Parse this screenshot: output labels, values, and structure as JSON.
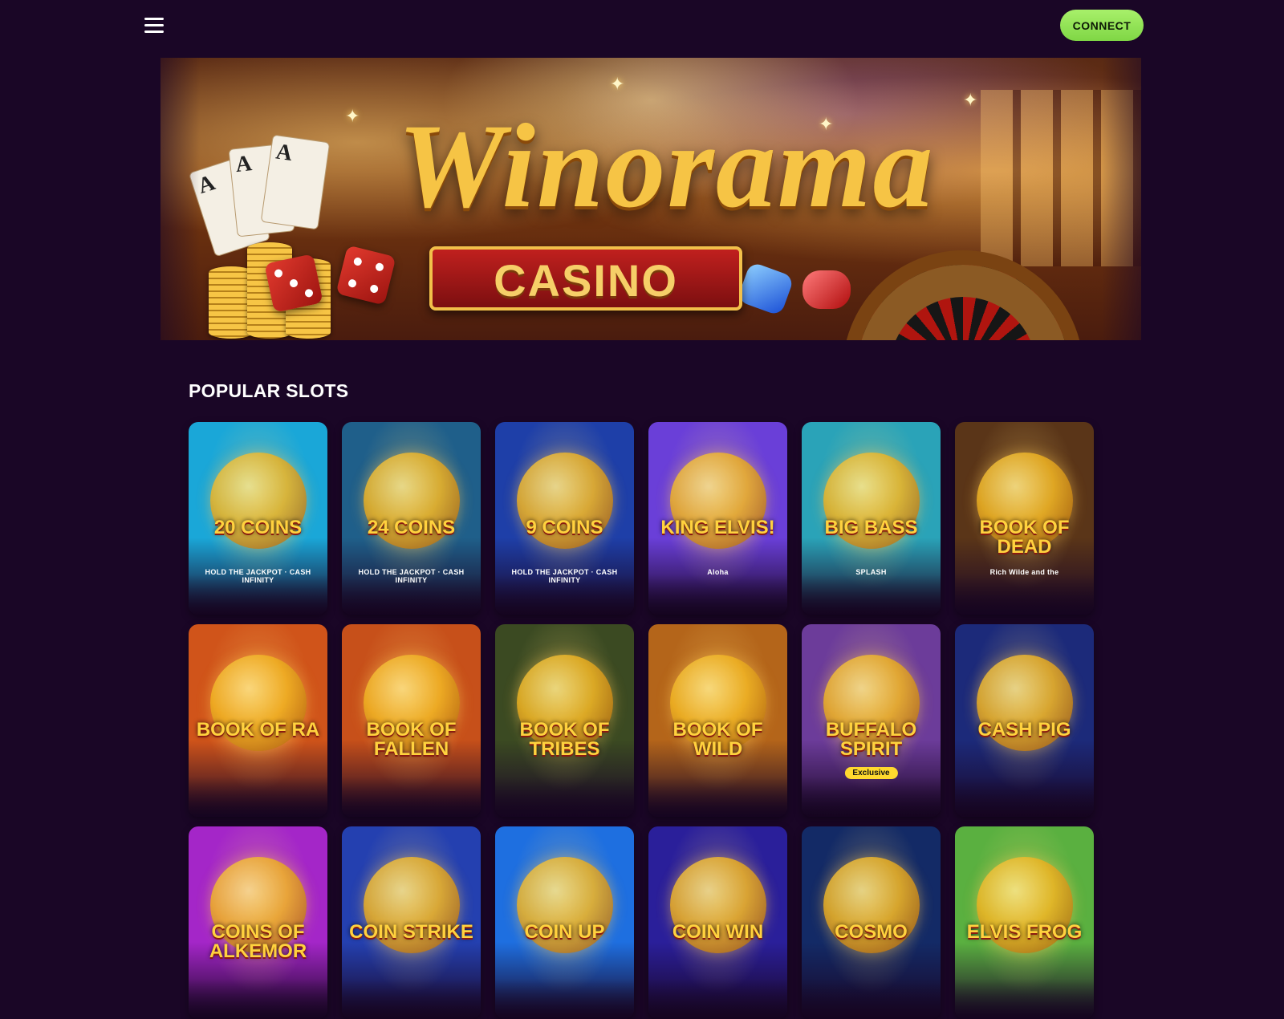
{
  "header": {
    "menu_icon": "hamburger-menu-icon",
    "connect_label": "CONNECT",
    "accent_color": "#8fe356"
  },
  "hero": {
    "brand": "Winorama",
    "brand_sub": "CASINO"
  },
  "section": {
    "title": "POPULAR SLOTS"
  },
  "slots": [
    {
      "title": "20 Coins",
      "sub": "HOLD THE JACKPOT · CASH INFINITY",
      "bg": "#1aa7d8"
    },
    {
      "title": "24 Coins",
      "sub": "HOLD THE JACKPOT · CASH INFINITY",
      "bg": "#1f5f8a"
    },
    {
      "title": "9 Coins",
      "sub": "HOLD THE JACKPOT · CASH INFINITY",
      "bg": "#1e3fa8"
    },
    {
      "title": "King Elvis!",
      "sub": "Aloha",
      "bg": "#6a3fd8"
    },
    {
      "title": "Big Bass",
      "sub": "SPLASH",
      "bg": "#2aa3b8"
    },
    {
      "title": "Book of Dead",
      "sub": "Rich Wilde and the",
      "bg": "#5a3518"
    },
    {
      "title": "Book of Ra",
      "sub": "",
      "bg": "#d0541a"
    },
    {
      "title": "Book of Fallen",
      "sub": "",
      "bg": "#c7501a"
    },
    {
      "title": "Book of Tribes",
      "sub": "",
      "bg": "#3b4a22"
    },
    {
      "title": "Book of Wild",
      "sub": "",
      "bg": "#b4651a"
    },
    {
      "title": "Buffalo Spirit",
      "sub": "Exclusive",
      "bg": "#6c3c9a"
    },
    {
      "title": "Cash Pig",
      "sub": "",
      "bg": "#1c2a7a"
    },
    {
      "title": "Coins of Alkemor",
      "sub": "",
      "bg": "#a426c8"
    },
    {
      "title": "Coin Strike",
      "sub": "",
      "bg": "#2440b0"
    },
    {
      "title": "Coin Up",
      "sub": "",
      "bg": "#1e6fe0"
    },
    {
      "title": "Coin Win",
      "sub": "",
      "bg": "#2a1f9a"
    },
    {
      "title": "Cosmo",
      "sub": "",
      "bg": "#132a66"
    },
    {
      "title": "Elvis Frog",
      "sub": "",
      "bg": "#5ab040"
    }
  ]
}
